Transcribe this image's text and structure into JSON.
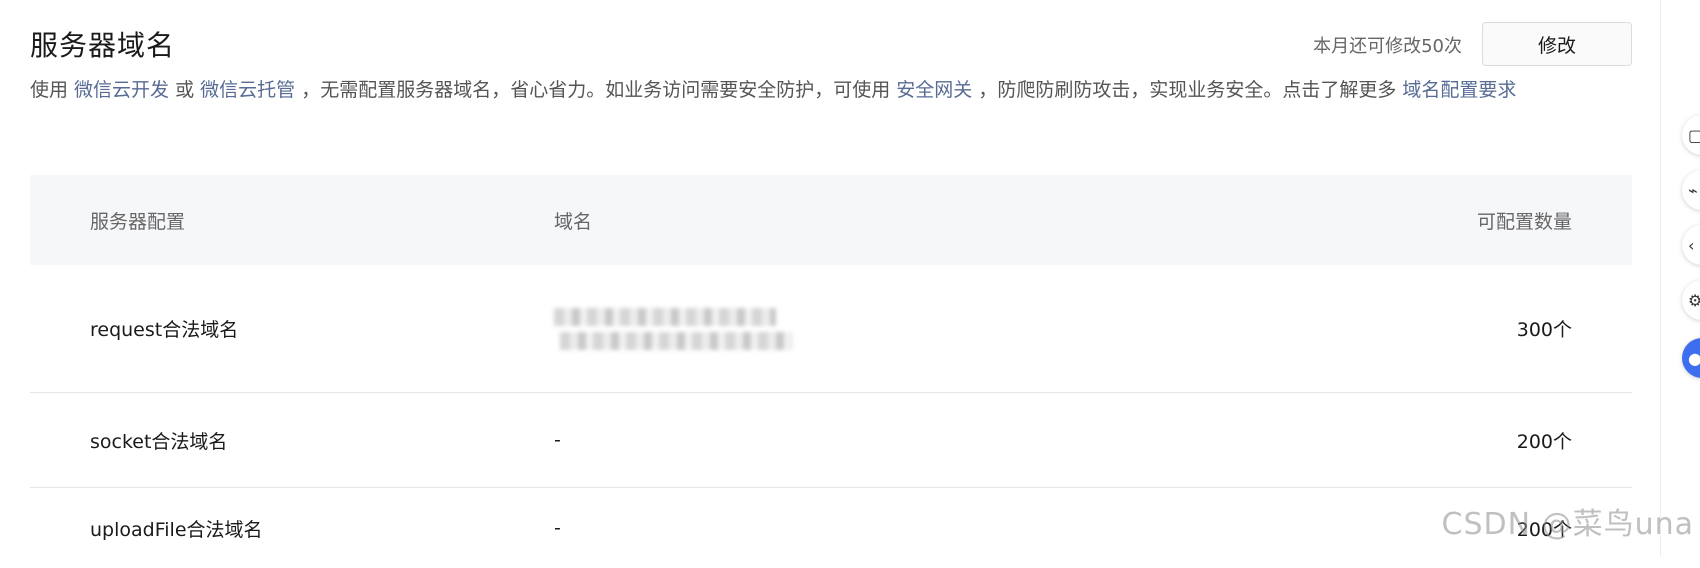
{
  "header": {
    "title": "服务器域名",
    "quota_text": "本月还可修改50次",
    "edit_label": "修改"
  },
  "description": {
    "p1": "使用 ",
    "link1": "微信云开发",
    "p2": " 或 ",
    "link2": "微信云托管",
    "p3": " ，无需配置服务器域名，省心省力。如业务访问需要安全防护，可使用 ",
    "link3": "安全网关",
    "p4": " ，防爬防刷防攻击，实现业务安全。点击了解更多 ",
    "link4": "域名配置要求"
  },
  "table": {
    "headers": [
      "服务器配置",
      "域名",
      "可配置数量"
    ],
    "rows": [
      {
        "config": "request合法域名",
        "domain": "",
        "count": "300个"
      },
      {
        "config": "socket合法域名",
        "domain": "-",
        "count": "200个"
      },
      {
        "config": "uploadFile合法域名",
        "domain": "-",
        "count": "200个"
      }
    ]
  },
  "side_float": {
    "icons": [
      "copy-icon",
      "link-icon",
      "share-icon",
      "settings-icon",
      "assistant-icon"
    ]
  },
  "watermark": "CSDN @菜鸟una"
}
